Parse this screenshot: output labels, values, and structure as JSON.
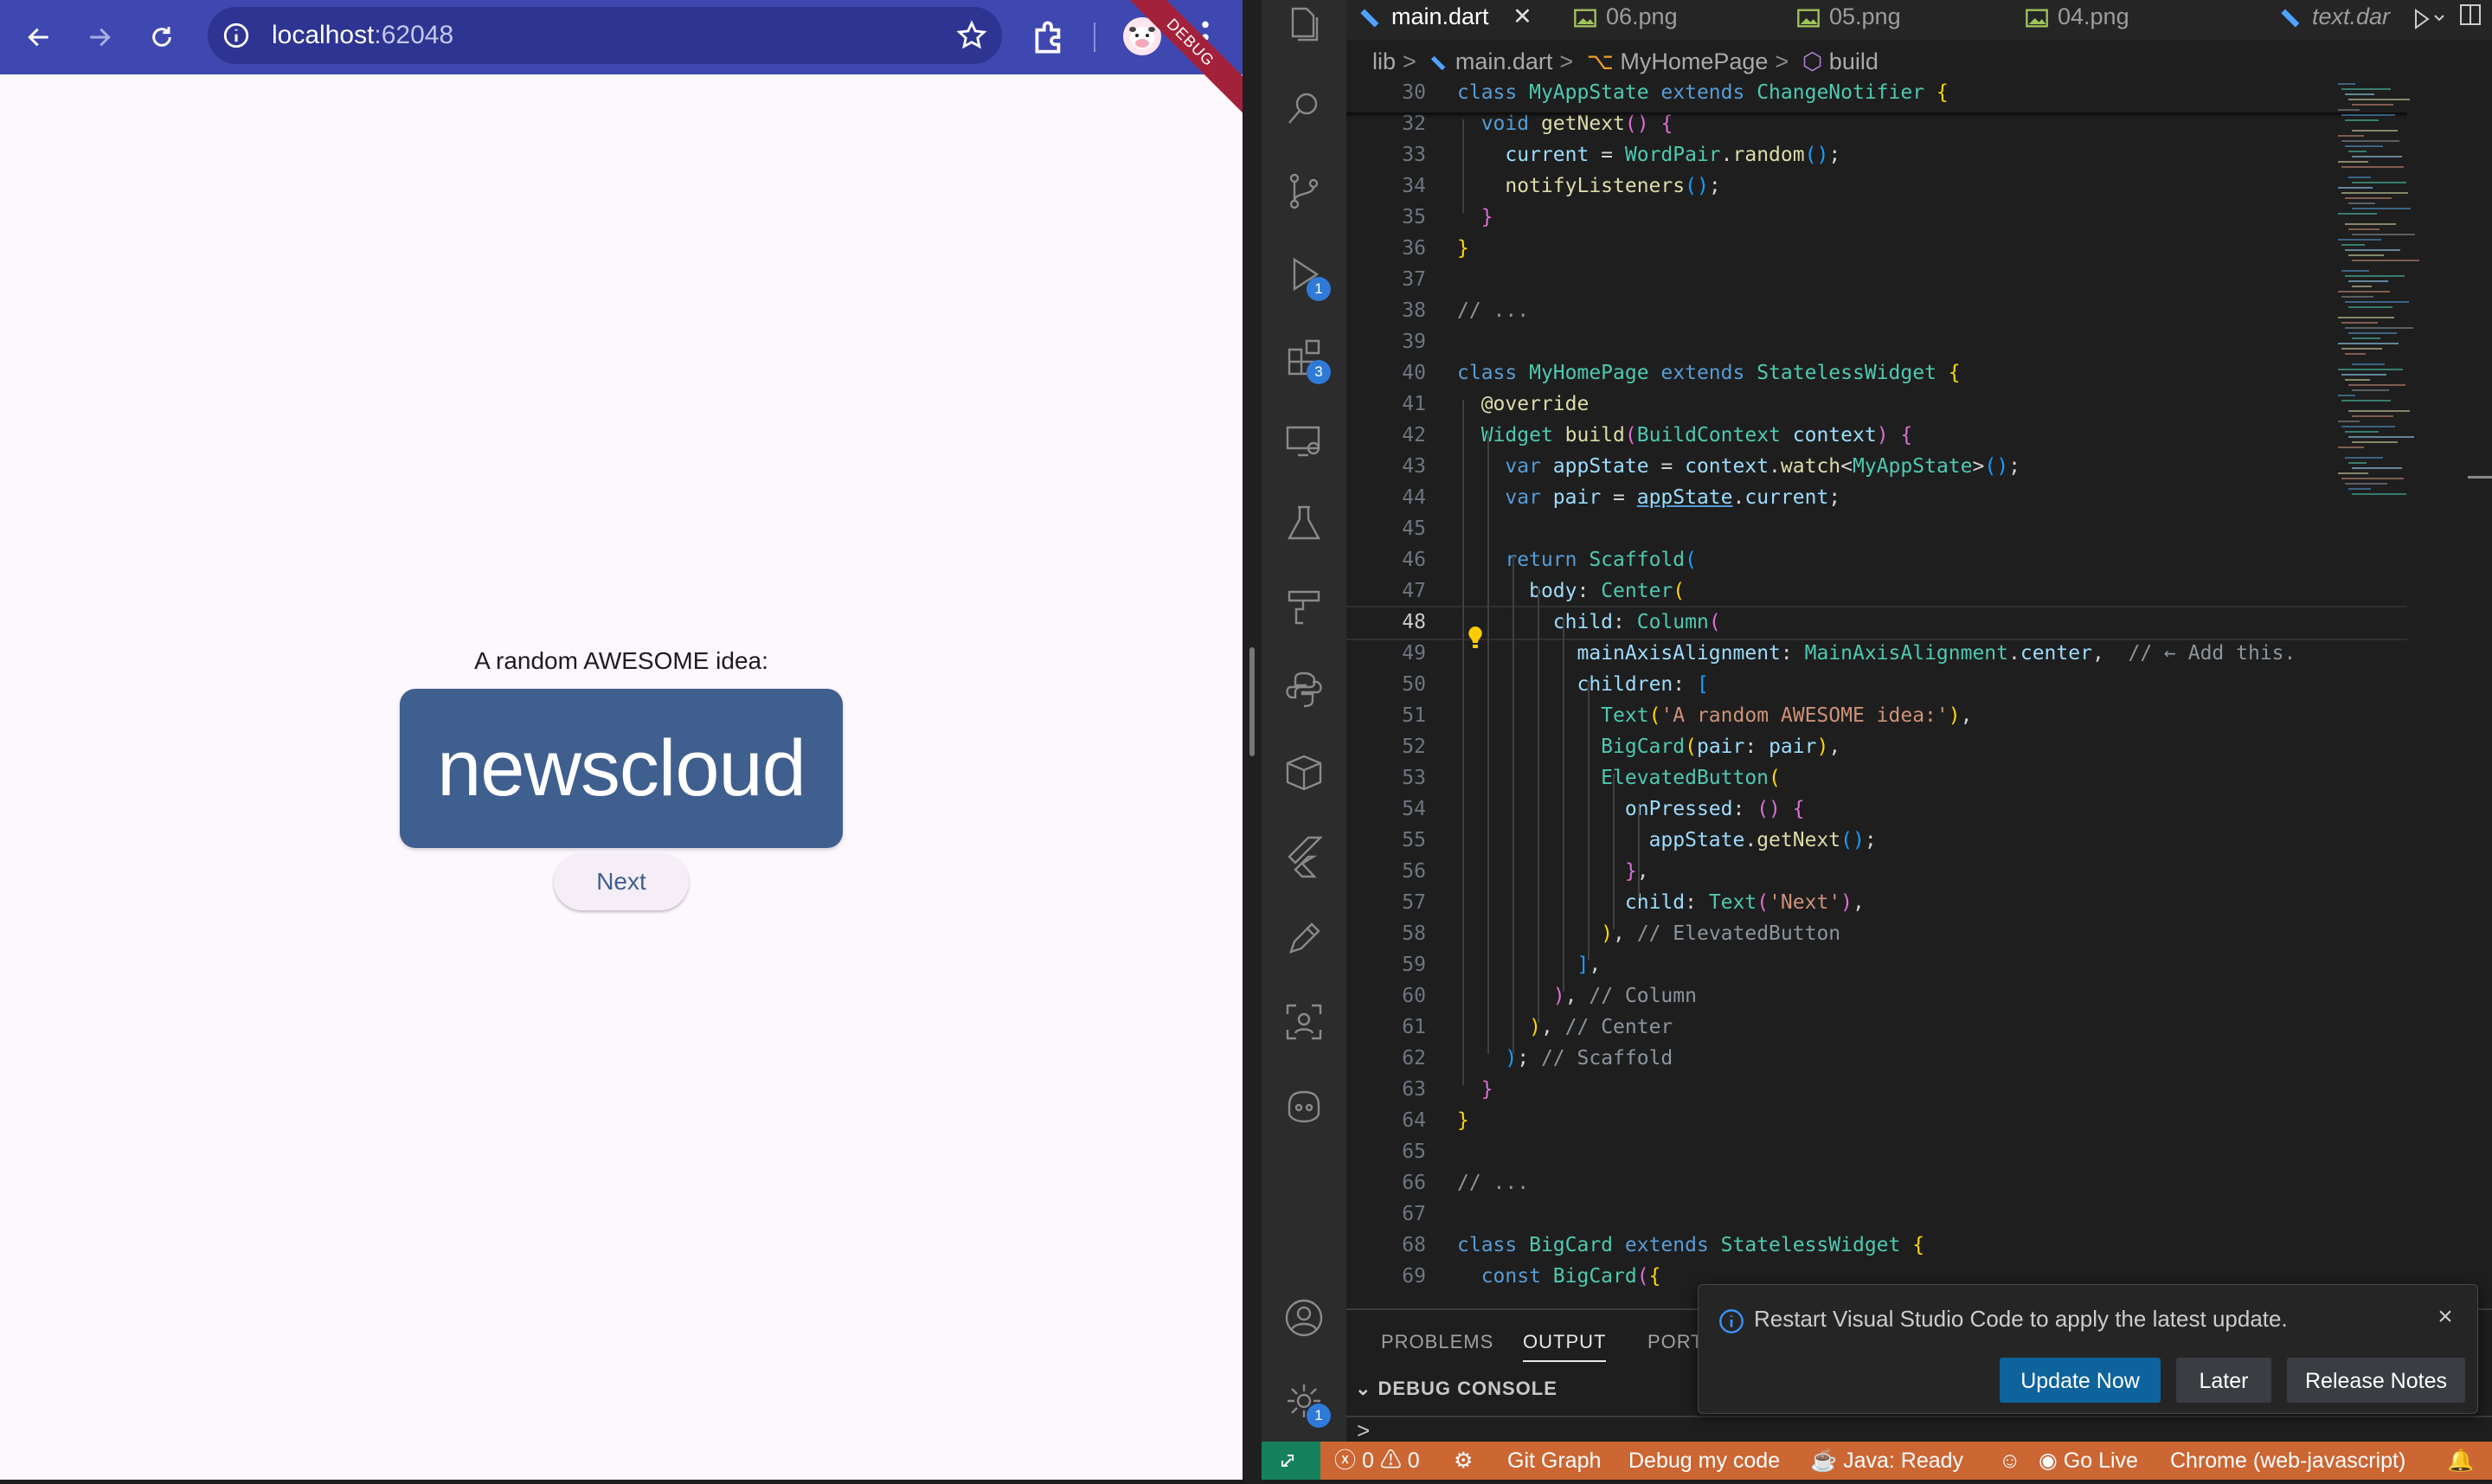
{
  "browser": {
    "url_host": "localhost",
    "url_port": ":62048",
    "debug_banner": "DEBUG"
  },
  "app": {
    "label": "A random AWESOME idea:",
    "card_text": "newscloud",
    "next_label": "Next"
  },
  "vscode": {
    "tabs": [
      {
        "label": "main.dart",
        "active": true
      },
      {
        "label": "06.png"
      },
      {
        "label": "05.png"
      },
      {
        "label": "04.png"
      },
      {
        "label": "text.dar"
      }
    ],
    "breadcrumb": [
      "lib",
      "main.dart",
      "MyHomePage",
      "build"
    ],
    "activity_badges": {
      "run": "1",
      "extensions": "3",
      "settings": "1"
    },
    "line_numbers": [
      "30",
      "32",
      "33",
      "34",
      "35",
      "36",
      "37",
      "38",
      "39",
      "40",
      "41",
      "42",
      "43",
      "44",
      "45",
      "46",
      "47",
      "48",
      "49",
      "50",
      "51",
      "52",
      "53",
      "54",
      "55",
      "56",
      "57",
      "58",
      "59",
      "60",
      "61",
      "62",
      "63",
      "64",
      "65",
      "66",
      "67",
      "68",
      "69"
    ],
    "panel_tabs": [
      "PROBLEMS",
      "OUTPUT",
      "PORT"
    ],
    "debug_console": "DEBUG CONSOLE",
    "prompt": ">",
    "notification": {
      "message": "Restart Visual Studio Code to apply the latest update.",
      "update_now": "Update Now",
      "later": "Later",
      "release_notes": "Release Notes"
    },
    "status": {
      "errors": "0",
      "warnings": "0",
      "git_graph": "Git Graph",
      "debug": "Debug my code",
      "java": "Java: Ready",
      "go_live": "Go Live",
      "target": "Chrome (web-javascript)"
    },
    "colors": {
      "status_bar": "#cc6633",
      "remote": "#16825d",
      "accent": "#2f7ad9"
    }
  }
}
